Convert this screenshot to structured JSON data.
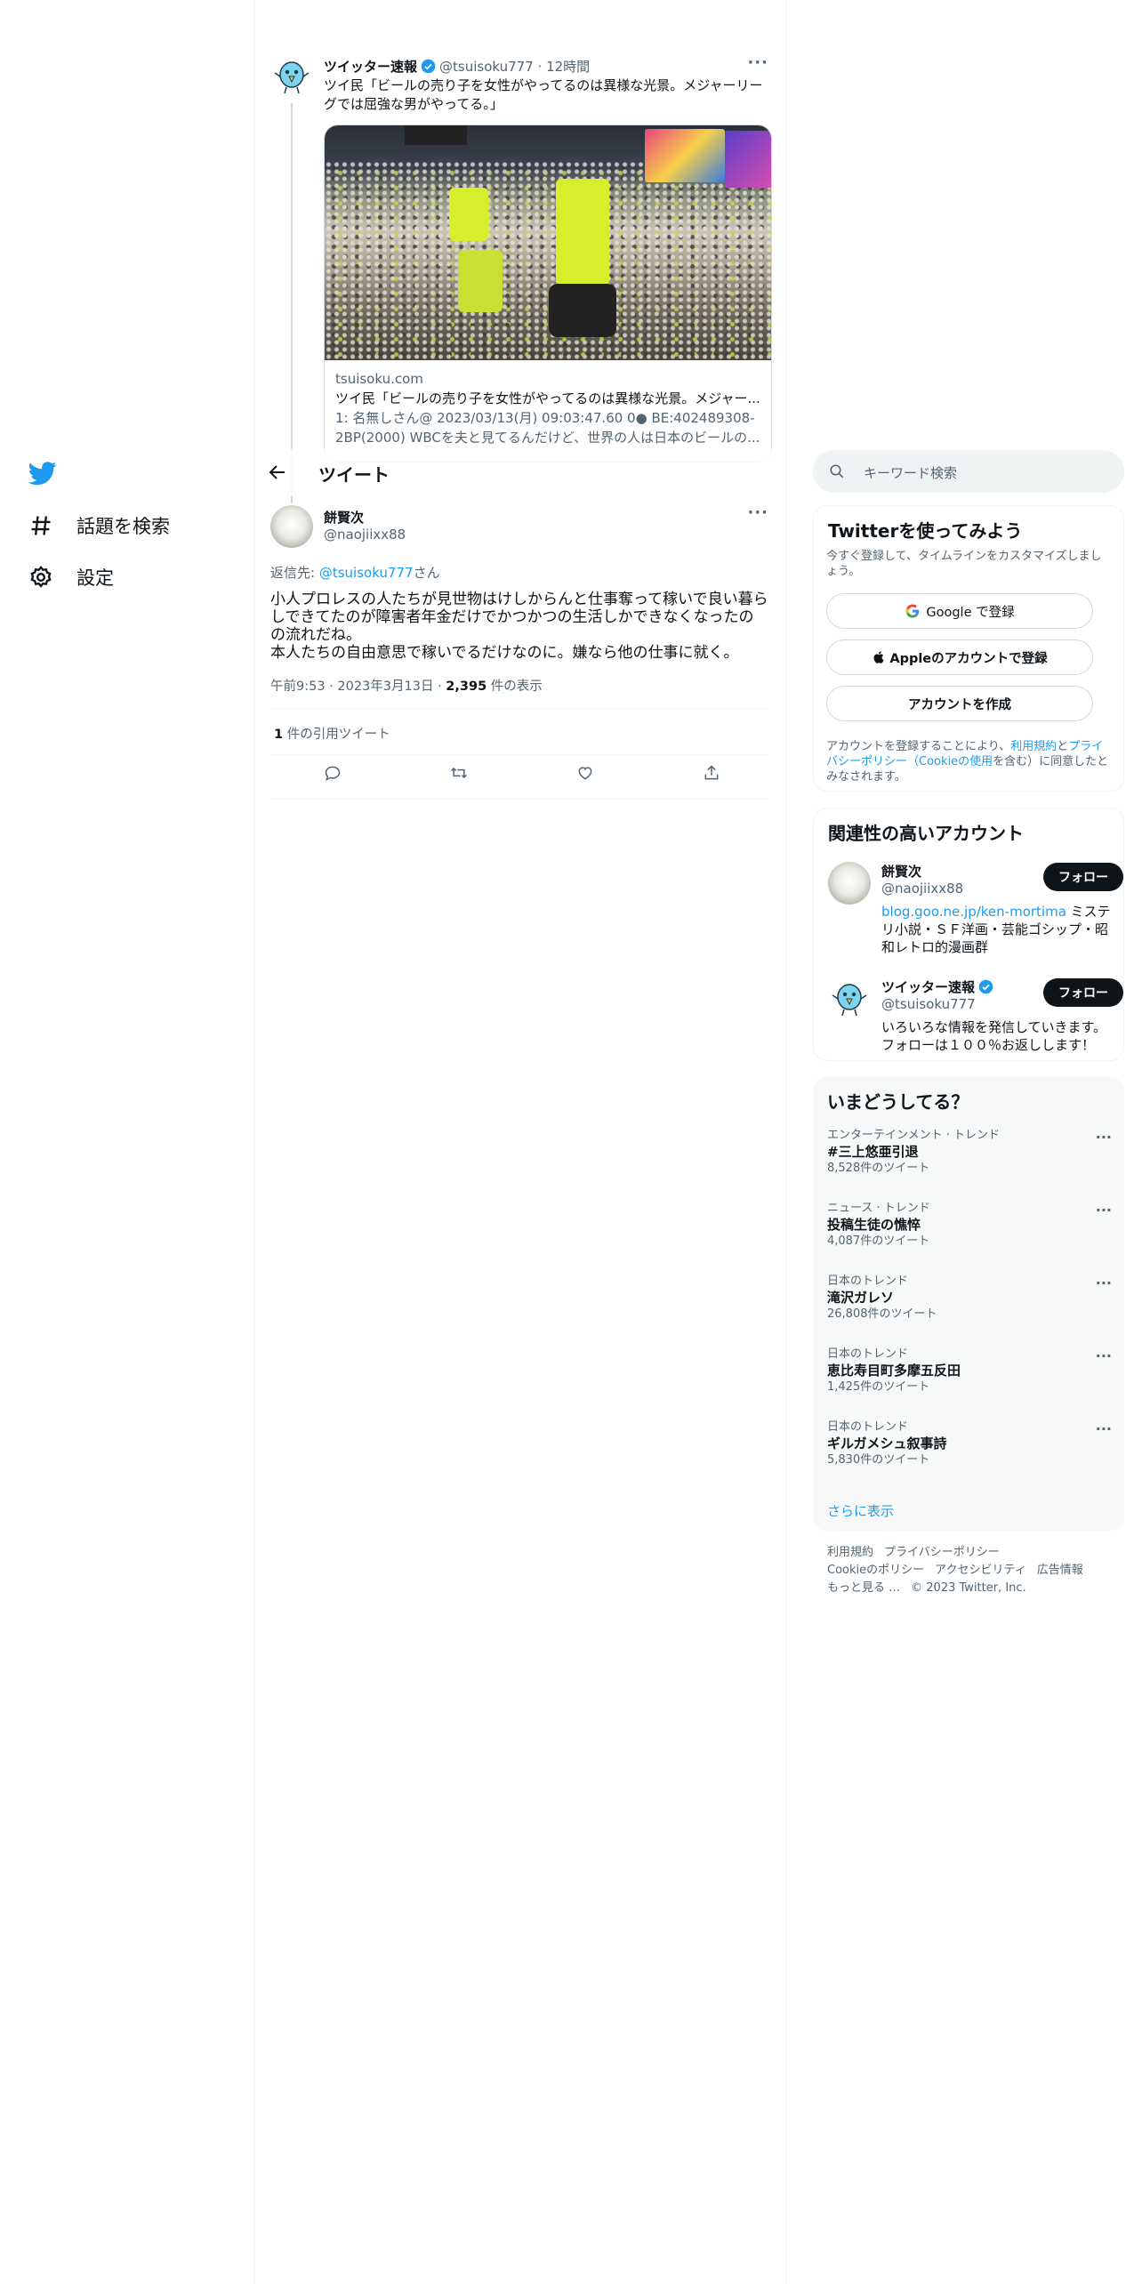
{
  "nav": {
    "items": [
      {
        "label": "話題を検索",
        "icon": "hashtag-icon"
      },
      {
        "label": "設定",
        "icon": "gear-icon"
      }
    ]
  },
  "parent_tweet": {
    "name": "ツイッター速報",
    "handle": "@tsuisoku777",
    "time": "12時間",
    "text": "ツイ民「ビールの売り子を女性がやってるのは異様な光景。メジャーリーグでは屈強な男がやってる。」",
    "card": {
      "domain": "tsuisoku.com",
      "title": "ツイ民「ビールの売り子を女性がやってるのは異様な光景。メジャー...",
      "description": "1: 名無しさん@ 2023/03/13(月) 09:03:47.60 0● BE:402489308-2BP(2000) WBCを夫と見てるんだけど、世界の人は日本のビールの..."
    }
  },
  "header": {
    "title": "ツイート"
  },
  "focus_tweet": {
    "name": "餅賢次",
    "handle": "@naojiixx88",
    "reply_prefix": "返信先: ",
    "reply_handle": "@tsuisoku777",
    "reply_suffix": "さん",
    "text": "小人プロレスの人たちが見世物はけしからんと仕事奪って稼いで良い暮らしできてたのが障害者年金だけでかつかつの生活しかできなくなったのの流れだね。\n本人たちの自由意思で稼いでるだけなのに。嫌なら他の仕事に就く。",
    "time": "午前9:53",
    "date": "2023年3月13日",
    "views_count": "2,395",
    "views_label": " 件の表示",
    "quote_count": "1",
    "quote_label": " 件の引用ツイート"
  },
  "search": {
    "placeholder": "キーワード検索"
  },
  "signup": {
    "title": "Twitterを使ってみよう",
    "subtitle": "今すぐ登録して、タイムラインをカスタマイズしましょう。",
    "google_label": "Google で登録",
    "apple_label": "Appleのアカウントで登録",
    "create_label": "アカウントを作成",
    "note_prefix": "アカウントを登録することにより、",
    "terms_link": "利用規約",
    "and": "と",
    "privacy_link": "プライバシーポリシー（Cookieの使用",
    "note_suffix": "を含む）に同意したとみなされます。"
  },
  "relevant": {
    "title": "関連性の高いアカウント",
    "follow_label": "フォロー",
    "accounts": [
      {
        "name": "餅賢次",
        "handle": "@naojiixx88",
        "link": "blog.goo.ne.jp/ken-mortima",
        "bio": " ミステリ小説・ＳＦ洋画・芸能ゴシップ・昭和レトロ的漫画群"
      },
      {
        "name": "ツイッター速報",
        "handle": "@tsuisoku777",
        "link": "",
        "bio": "いろいろな情報を発信していきます。フォローは１００％お返しします！"
      }
    ]
  },
  "trends": {
    "title": "いまどうしてる？",
    "items": [
      {
        "context": "エンターテインメント · トレンド",
        "title": "#三上悠亜引退",
        "count": "8,528件のツイート"
      },
      {
        "context": "ニュース · トレンド",
        "title": "投稿生徒の憔悴",
        "count": "4,087件のツイート"
      },
      {
        "context": "日本のトレンド",
        "title": "滝沢ガレソ",
        "count": "26,808件のツイート"
      },
      {
        "context": "日本のトレンド",
        "title": "恵比寿目町多摩五反田",
        "count": "1,425件のツイート"
      },
      {
        "context": "日本のトレンド",
        "title": "ギルガメシュ叙事詩",
        "count": "5,830件のツイート"
      }
    ],
    "show_more": "さらに表示"
  },
  "footer": {
    "links": [
      "利用規約",
      "プライバシーポリシー",
      "Cookieのポリシー",
      "アクセシビリティ",
      "広告情報",
      "もっと見る …",
      "© 2023 Twitter, Inc."
    ]
  },
  "colors": {
    "accent": "#1d9bf0",
    "text": "#0f1419",
    "secondary": "#536471"
  }
}
